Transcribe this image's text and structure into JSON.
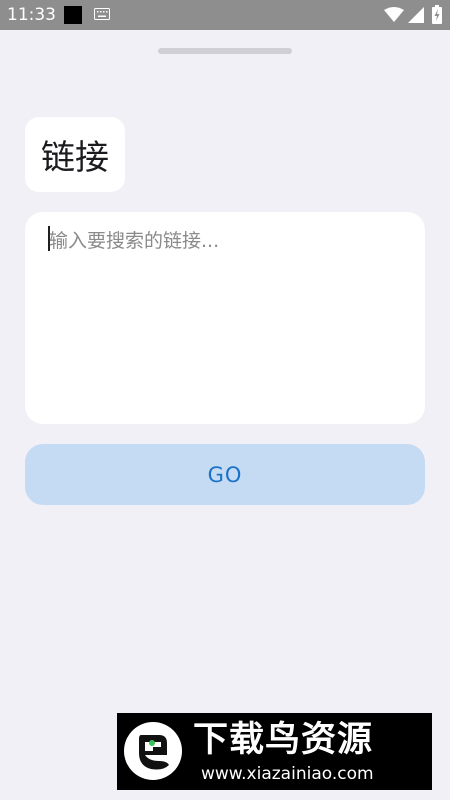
{
  "status_bar": {
    "time": "11:33",
    "icons": [
      "notification-square-icon",
      "keyboard-icon",
      "wifi-icon",
      "cellular-signal-icon",
      "battery-charging-icon"
    ]
  },
  "sheet": {
    "title": "链接",
    "input": {
      "value": "",
      "placeholder": "输入要搜索的链接..."
    },
    "go_label": "GO"
  },
  "watermark": {
    "title": "下载鸟资源",
    "url": "www.xiazainiao.com"
  },
  "colors": {
    "background": "#f1f0f6",
    "status_bar": "#8e8e8e",
    "card": "#ffffff",
    "button_bg": "#c5daf3",
    "button_text": "#1a73c7",
    "watermark_bg": "#000000"
  }
}
